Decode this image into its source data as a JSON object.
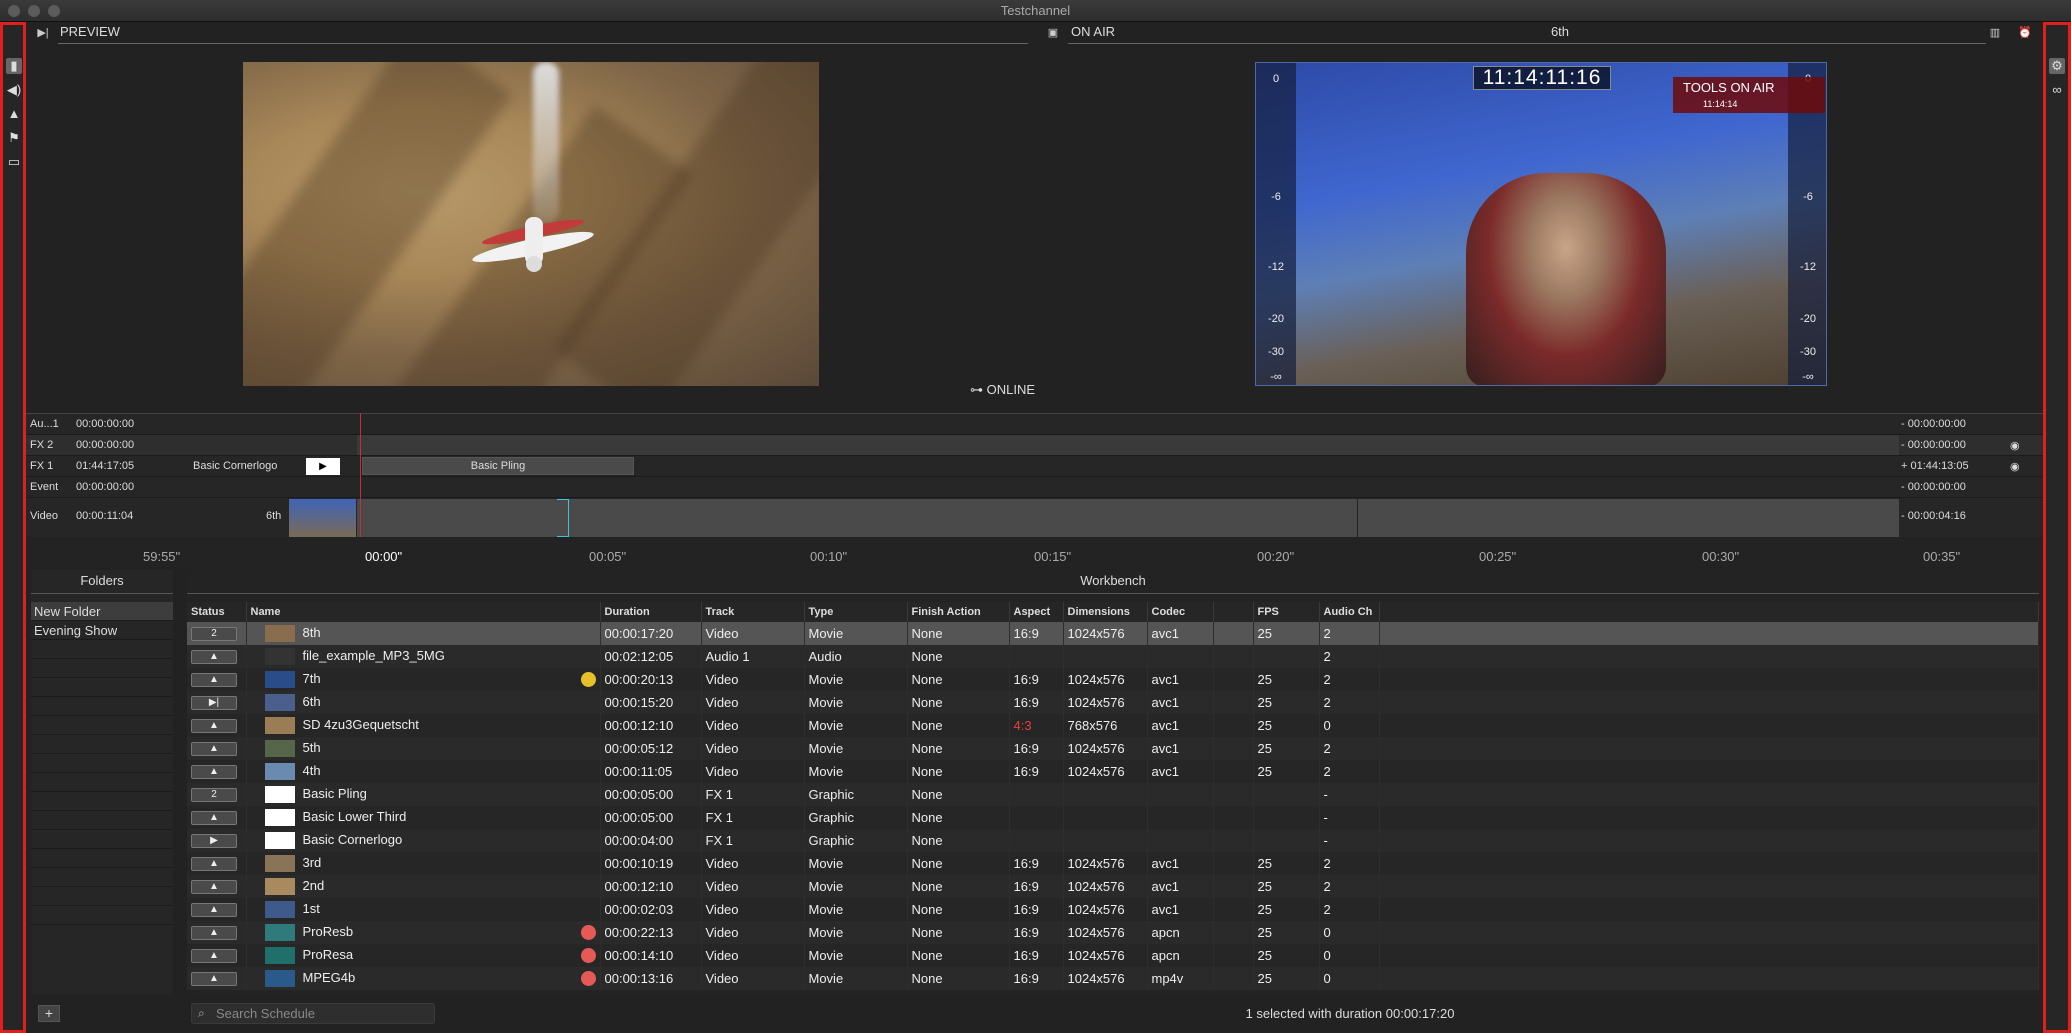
{
  "window": {
    "title": "Testchannel"
  },
  "left_sidebar": {
    "icons": [
      "library-icon",
      "audio-icon",
      "mountains-icon",
      "flag-icon",
      "window-icon"
    ]
  },
  "right_sidebar": {
    "icons": [
      "gear-icon",
      "glasses-icon"
    ]
  },
  "preview": {
    "label": "PREVIEW"
  },
  "onair": {
    "label": "ON AIR",
    "clip_name": "6th",
    "clock": "11:14:11:16",
    "logo_text": "TOOLS ON AIR",
    "logo_time": "11:14:14",
    "meter_left": [
      "0",
      "-6",
      "-12",
      "-20",
      "-30",
      "-∞"
    ],
    "meter_right": [
      "0",
      "-6",
      "-12",
      "-20",
      "-30",
      "-∞"
    ]
  },
  "online_status": "ONLINE",
  "tracks": [
    {
      "name": "Au...1",
      "time": "00:00:00:00",
      "right": "- 00:00:00:00"
    },
    {
      "name": "FX 2",
      "time": "00:00:00:00",
      "right": "- 00:00:00:00"
    },
    {
      "name": "FX 1",
      "time": "01:44:17:05",
      "clip_label": "Basic Cornerlogo",
      "lane_clip": "Basic Pling",
      "right": "+ 01:44:13:05"
    },
    {
      "name": "Event",
      "time": "00:00:00:00",
      "right": "- 00:00:00:00"
    },
    {
      "name": "Video",
      "time": "00:00:11:04",
      "clip_label": "6th",
      "right": "- 00:00:04:16"
    }
  ],
  "ruler": [
    "59:55\"",
    "00:00\"",
    "00:05\"",
    "00:10\"",
    "00:15\"",
    "00:20\"",
    "00:25\"",
    "00:30\"",
    "00:35\""
  ],
  "folders": {
    "title": "Folders",
    "items": [
      "New Folder",
      "Evening Show"
    ]
  },
  "workbench": {
    "title": "Workbench",
    "columns": [
      "Status",
      "Name",
      "Duration",
      "Track",
      "Type",
      "Finish Action",
      "Aspect",
      "Dimensions",
      "Codec",
      "",
      "FPS",
      "Audio Ch"
    ],
    "rows": [
      {
        "status": "2",
        "name": "8th",
        "duration": "00:00:17:20",
        "track": "Video",
        "type": "Movie",
        "finish": "None",
        "aspect": "16:9",
        "dims": "1024x576",
        "codec": "avc1",
        "fps": "25",
        "audio": "2",
        "selected": true,
        "thumb": "#8a6d4c"
      },
      {
        "status": "▲",
        "name": "file_example_MP3_5MG",
        "duration": "00:02:12:05",
        "track": "Audio 1",
        "type": "Audio",
        "finish": "None",
        "aspect": "",
        "dims": "",
        "codec": "",
        "fps": "",
        "audio": "2",
        "thumb": "#333"
      },
      {
        "status": "▲",
        "name": "7th",
        "duration": "00:00:20:13",
        "track": "Video",
        "type": "Movie",
        "finish": "None",
        "aspect": "16:9",
        "dims": "1024x576",
        "codec": "avc1",
        "fps": "25",
        "audio": "2",
        "dot": "#e6c02a",
        "thumb": "#2a4d8a"
      },
      {
        "status": "▶|",
        "name": "6th",
        "duration": "00:00:15:20",
        "track": "Video",
        "type": "Movie",
        "finish": "None",
        "aspect": "16:9",
        "dims": "1024x576",
        "codec": "avc1",
        "fps": "25",
        "audio": "2",
        "thumb": "#4b5f8c"
      },
      {
        "status": "▲",
        "name": "SD 4zu3Gequetscht",
        "duration": "00:00:12:10",
        "track": "Video",
        "type": "Movie",
        "finish": "None",
        "aspect": "4:3",
        "dims": "768x576",
        "codec": "avc1",
        "fps": "25",
        "audio": "0",
        "aspect_red": true,
        "thumb": "#9a7c55"
      },
      {
        "status": "▲",
        "name": "5th",
        "duration": "00:00:05:12",
        "track": "Video",
        "type": "Movie",
        "finish": "None",
        "aspect": "16:9",
        "dims": "1024x576",
        "codec": "avc1",
        "fps": "25",
        "audio": "2",
        "thumb": "#56664a"
      },
      {
        "status": "▲",
        "name": "4th",
        "duration": "00:00:11:05",
        "track": "Video",
        "type": "Movie",
        "finish": "None",
        "aspect": "16:9",
        "dims": "1024x576",
        "codec": "avc1",
        "fps": "25",
        "audio": "2",
        "thumb": "#6a8ab0"
      },
      {
        "status": "2",
        "name": "Basic Pling",
        "duration": "00:00:05:00",
        "track": "FX 1",
        "type": "Graphic",
        "finish": "None",
        "aspect": "",
        "dims": "",
        "codec": "",
        "fps": "",
        "audio": "-",
        "thumb": "#ffffff"
      },
      {
        "status": "▲",
        "name": "Basic Lower Third",
        "duration": "00:00:05:00",
        "track": "FX 1",
        "type": "Graphic",
        "finish": "None",
        "aspect": "",
        "dims": "",
        "codec": "",
        "fps": "",
        "audio": "-",
        "thumb": "#ffffff"
      },
      {
        "status": "▶",
        "name": "Basic Cornerlogo",
        "duration": "00:00:04:00",
        "track": "FX 1",
        "type": "Graphic",
        "finish": "None",
        "aspect": "",
        "dims": "",
        "codec": "",
        "fps": "",
        "audio": "-",
        "thumb": "#ffffff"
      },
      {
        "status": "▲",
        "name": "3rd",
        "duration": "00:00:10:19",
        "track": "Video",
        "type": "Movie",
        "finish": "None",
        "aspect": "16:9",
        "dims": "1024x576",
        "codec": "avc1",
        "fps": "25",
        "audio": "2",
        "thumb": "#8a7458"
      },
      {
        "status": "▲",
        "name": "2nd",
        "duration": "00:00:12:10",
        "track": "Video",
        "type": "Movie",
        "finish": "None",
        "aspect": "16:9",
        "dims": "1024x576",
        "codec": "avc1",
        "fps": "25",
        "audio": "2",
        "thumb": "#a88a5e"
      },
      {
        "status": "▲",
        "name": "1st",
        "duration": "00:00:02:03",
        "track": "Video",
        "type": "Movie",
        "finish": "None",
        "aspect": "16:9",
        "dims": "1024x576",
        "codec": "avc1",
        "fps": "25",
        "audio": "2",
        "thumb": "#3d5a8a"
      },
      {
        "status": "▲",
        "name": "ProResb",
        "duration": "00:00:22:13",
        "track": "Video",
        "type": "Movie",
        "finish": "None",
        "aspect": "16:9",
        "dims": "1024x576",
        "codec": "apcn",
        "fps": "25",
        "audio": "0",
        "dot": "#e55a56",
        "thumb": "#2f7a7a"
      },
      {
        "status": "▲",
        "name": "ProResa",
        "duration": "00:00:14:10",
        "track": "Video",
        "type": "Movie",
        "finish": "None",
        "aspect": "16:9",
        "dims": "1024x576",
        "codec": "apcn",
        "fps": "25",
        "audio": "0",
        "dot": "#e55a56",
        "thumb": "#1f6f6a"
      },
      {
        "status": "▲",
        "name": "MPEG4b",
        "duration": "00:00:13:16",
        "track": "Video",
        "type": "Movie",
        "finish": "None",
        "aspect": "16:9",
        "dims": "1024x576",
        "codec": "mp4v",
        "fps": "25",
        "audio": "0",
        "dot": "#e55a56",
        "thumb": "#2a5a8a"
      }
    ]
  },
  "search": {
    "placeholder": "Search Schedule"
  },
  "status_line": "1 selected with duration 00:00:17:20",
  "colors": {
    "sidebar_border": "#e0201c",
    "playhead": "#b33333"
  }
}
